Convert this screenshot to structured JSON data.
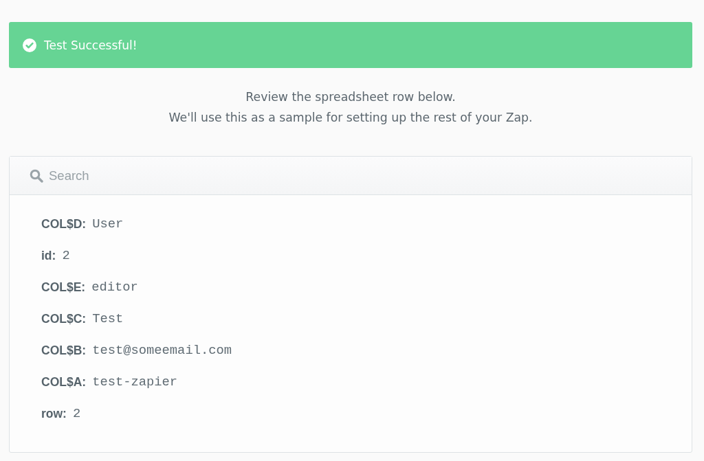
{
  "banner": {
    "kind": "success",
    "message": "Test Successful!"
  },
  "intro": [
    "Review the spreadsheet row below.",
    "We'll use this as a sample for setting up the rest of your Zap."
  ],
  "search": {
    "placeholder": "Search"
  },
  "fields": [
    {
      "label": "COL$D:",
      "value": "User"
    },
    {
      "label": "id:",
      "value": "2"
    },
    {
      "label": "COL$E:",
      "value": "editor"
    },
    {
      "label": "COL$C:",
      "value": "Test"
    },
    {
      "label": "COL$B:",
      "value": "test@someemail.com"
    },
    {
      "label": "COL$A:",
      "value": "test-zapier"
    },
    {
      "label": "row:",
      "value": "2"
    }
  ]
}
